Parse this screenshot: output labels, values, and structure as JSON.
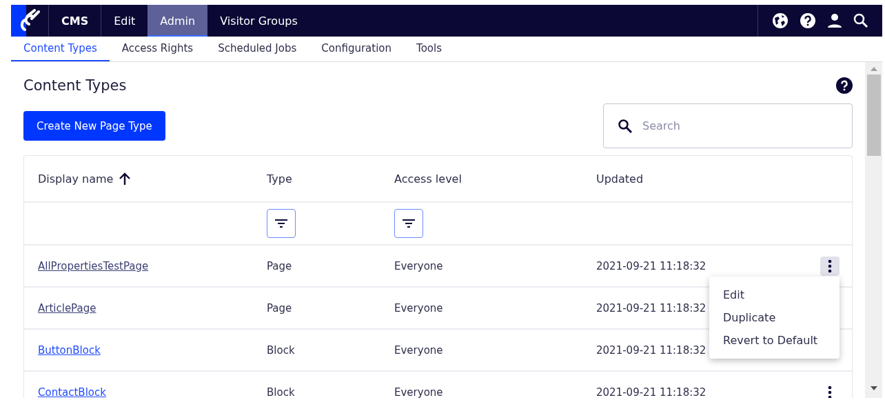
{
  "top_nav": [
    {
      "label": "CMS",
      "selected": false,
      "kind": "brand"
    },
    {
      "label": "Edit",
      "selected": false,
      "kind": "item"
    },
    {
      "label": "Admin",
      "selected": true,
      "kind": "item"
    },
    {
      "label": "Visitor Groups",
      "selected": false,
      "kind": "item"
    }
  ],
  "sub_tabs": [
    {
      "label": "Content Types",
      "selected": true
    },
    {
      "label": "Access Rights",
      "selected": false
    },
    {
      "label": "Scheduled Jobs",
      "selected": false
    },
    {
      "label": "Configuration",
      "selected": false
    },
    {
      "label": "Tools",
      "selected": false
    }
  ],
  "page_title": "Content Types",
  "create_button": "Create New Page Type",
  "search": {
    "placeholder": "Search"
  },
  "table": {
    "columns": [
      {
        "label": "Display name",
        "sorted": true,
        "filter": false
      },
      {
        "label": "Type",
        "sorted": false,
        "filter": true
      },
      {
        "label": "Access level",
        "sorted": false,
        "filter": true
      },
      {
        "label": "Updated",
        "sorted": false,
        "filter": false
      }
    ],
    "rows": [
      {
        "name": "AllPropertiesTestPage",
        "visited": true,
        "type": "Page",
        "access": "Everyone",
        "updated": "2021-09-21 11:18:32",
        "menu_open": true
      },
      {
        "name": "ArticlePage",
        "visited": true,
        "type": "Page",
        "access": "Everyone",
        "updated": "2021-09-21 11:18:32",
        "menu_open": false
      },
      {
        "name": "ButtonBlock",
        "visited": false,
        "type": "Block",
        "access": "Everyone",
        "updated": "2021-09-21 11:18:32",
        "menu_open": false
      },
      {
        "name": "ContactBlock",
        "visited": false,
        "type": "Block",
        "access": "Everyone",
        "updated": "2021-09-21 11:18:32",
        "menu_open": false
      }
    ]
  },
  "row_menu": [
    "Edit",
    "Duplicate",
    "Revert to Default"
  ]
}
